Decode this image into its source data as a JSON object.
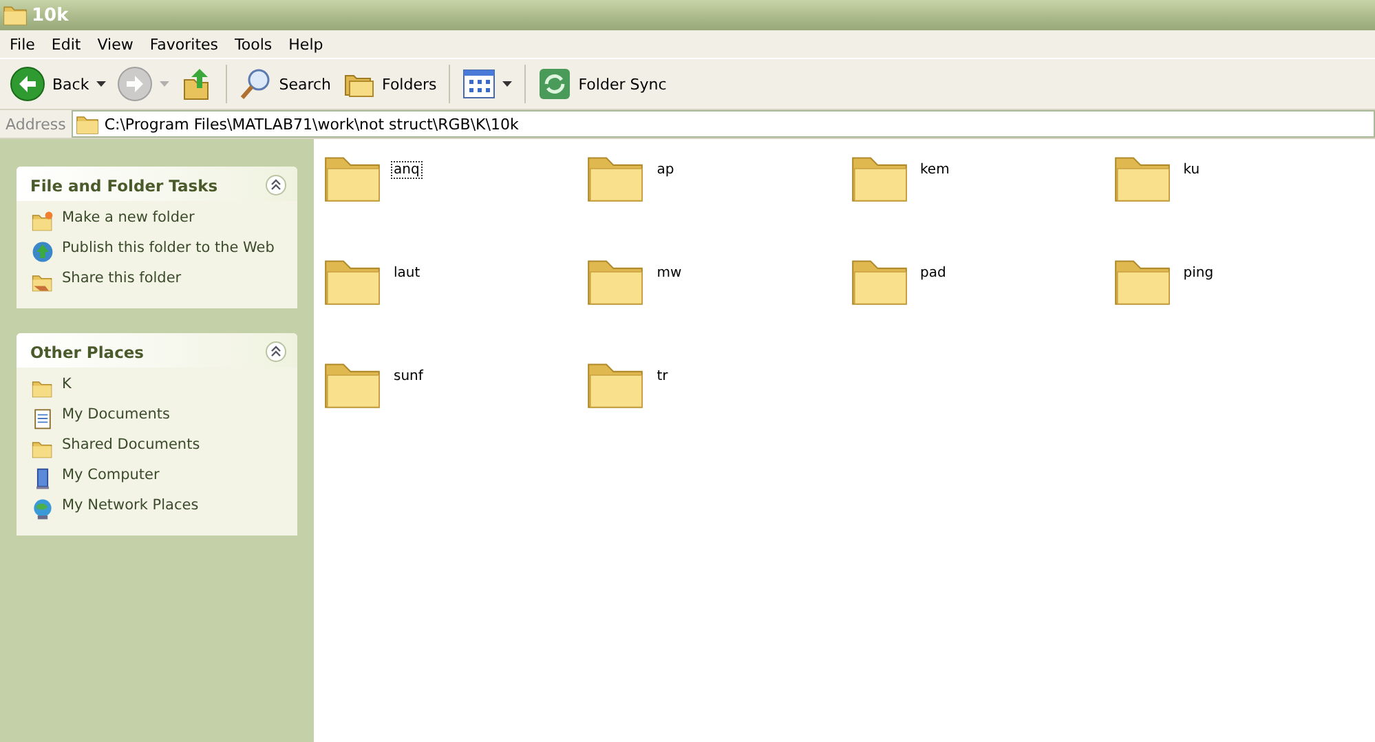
{
  "window": {
    "title": "10k"
  },
  "menu": [
    "File",
    "Edit",
    "View",
    "Favorites",
    "Tools",
    "Help"
  ],
  "toolbar": [
    {
      "kind": "back",
      "label": "Back"
    },
    {
      "kind": "forward",
      "disabled": true
    },
    {
      "kind": "up"
    },
    {
      "kind": "sep"
    },
    {
      "kind": "search",
      "label": "Search"
    },
    {
      "kind": "folders",
      "label": "Folders"
    },
    {
      "kind": "sep"
    },
    {
      "kind": "views"
    },
    {
      "kind": "sep"
    },
    {
      "kind": "sync",
      "label": "Folder Sync"
    }
  ],
  "address": {
    "label": "Address",
    "value": "C:\\Program Files\\MATLAB71\\work\\not struct\\RGB\\K\\10k"
  },
  "sidebar": [
    {
      "title": "File and Folder Tasks",
      "expanded": true,
      "items": [
        {
          "kind": "newfolder",
          "label": "Make a new folder"
        },
        {
          "kind": "web",
          "label": "Publish this folder to the Web"
        },
        {
          "kind": "share",
          "label": "Share this folder"
        }
      ]
    },
    {
      "title": "Other Places",
      "expanded": true,
      "items": [
        {
          "kind": "folder",
          "label": "K"
        },
        {
          "kind": "docs",
          "label": "My Documents"
        },
        {
          "kind": "folder",
          "label": "Shared Documents"
        },
        {
          "kind": "computer",
          "label": "My Computer"
        },
        {
          "kind": "network",
          "label": "My Network Places"
        }
      ]
    }
  ],
  "folders": [
    {
      "name": "anq",
      "focused": true
    },
    {
      "name": "ap",
      "focused": false
    },
    {
      "name": "kem",
      "focused": false
    },
    {
      "name": "ku",
      "focused": false
    },
    {
      "name": "laut",
      "focused": false
    },
    {
      "name": "mw",
      "focused": false
    },
    {
      "name": "pad",
      "focused": false
    },
    {
      "name": "ping",
      "focused": false
    },
    {
      "name": "sunf",
      "focused": false
    },
    {
      "name": "tr",
      "focused": false
    }
  ]
}
